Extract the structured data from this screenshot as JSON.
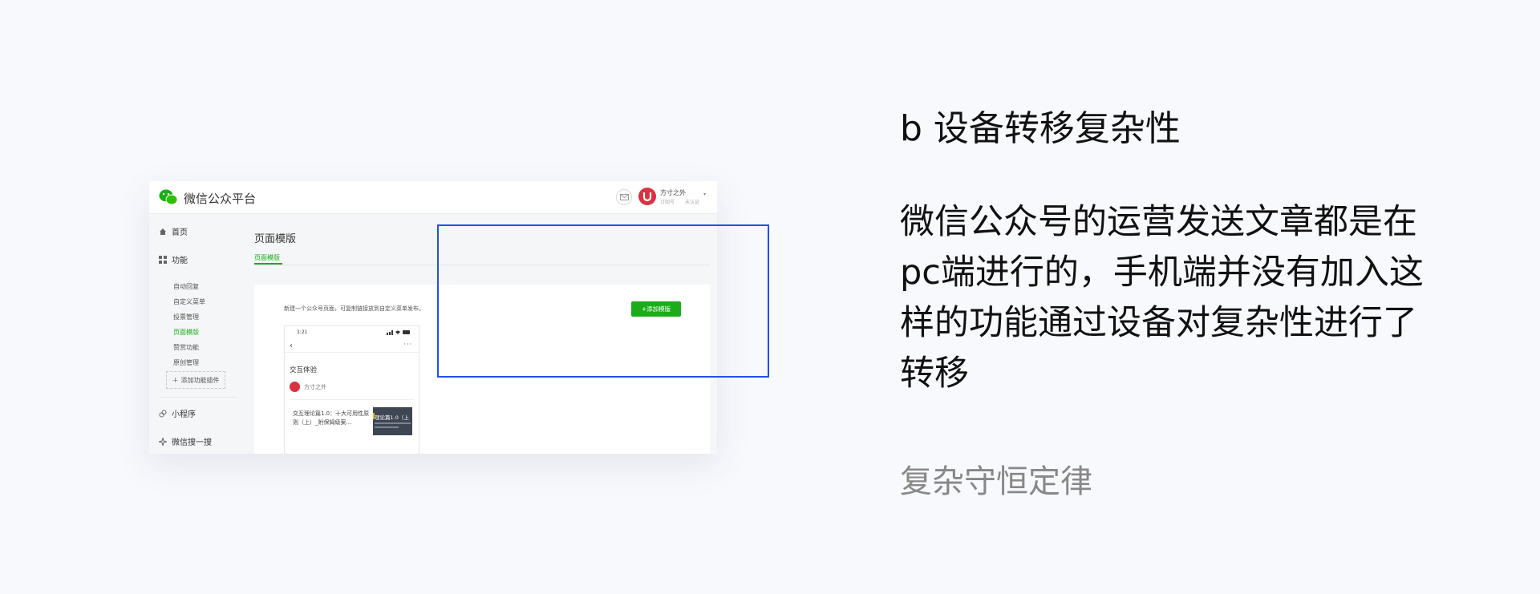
{
  "screenshot": {
    "brand": "微信公众平台",
    "account": {
      "name": "方寸之外",
      "sub1": "订阅号",
      "sub2": "未认证"
    },
    "sidebar": {
      "home": "首页",
      "features": "功能",
      "items": [
        "自动回复",
        "自定义菜单",
        "投票管理",
        "页面模版",
        "赞赏功能",
        "原创管理"
      ],
      "active_item": "页面模版",
      "add_plugin": "添加功能插件",
      "mini_program": "小程序",
      "wechat_search": "微信搜一搜"
    },
    "main": {
      "page_title": "页面模版",
      "tab": "页面模版",
      "description": "新建一个公众号页面，可复制链接放到自定义菜单发布。",
      "add_button": "添加模版"
    },
    "phone": {
      "time": "1:21",
      "title": "交互体验",
      "author": "方寸之外",
      "article_title": "交互理论篇1.0：十大可用性原则（上）_附保姆级案…",
      "thumb_text": "理论篇1.0（上"
    },
    "colors": {
      "accent_green": "#1aad19",
      "highlight_blue": "#2052e8",
      "avatar_red": "#d9333f"
    }
  },
  "slide": {
    "heading": "b 设备转移复杂性",
    "body_lines": [
      "微信公众号的运营发送文章都是在",
      "pc端进行的，手机端并没有加入这",
      "样的功能通过设备对复杂性进行了",
      "转移"
    ],
    "law": "复杂守恒定律"
  }
}
